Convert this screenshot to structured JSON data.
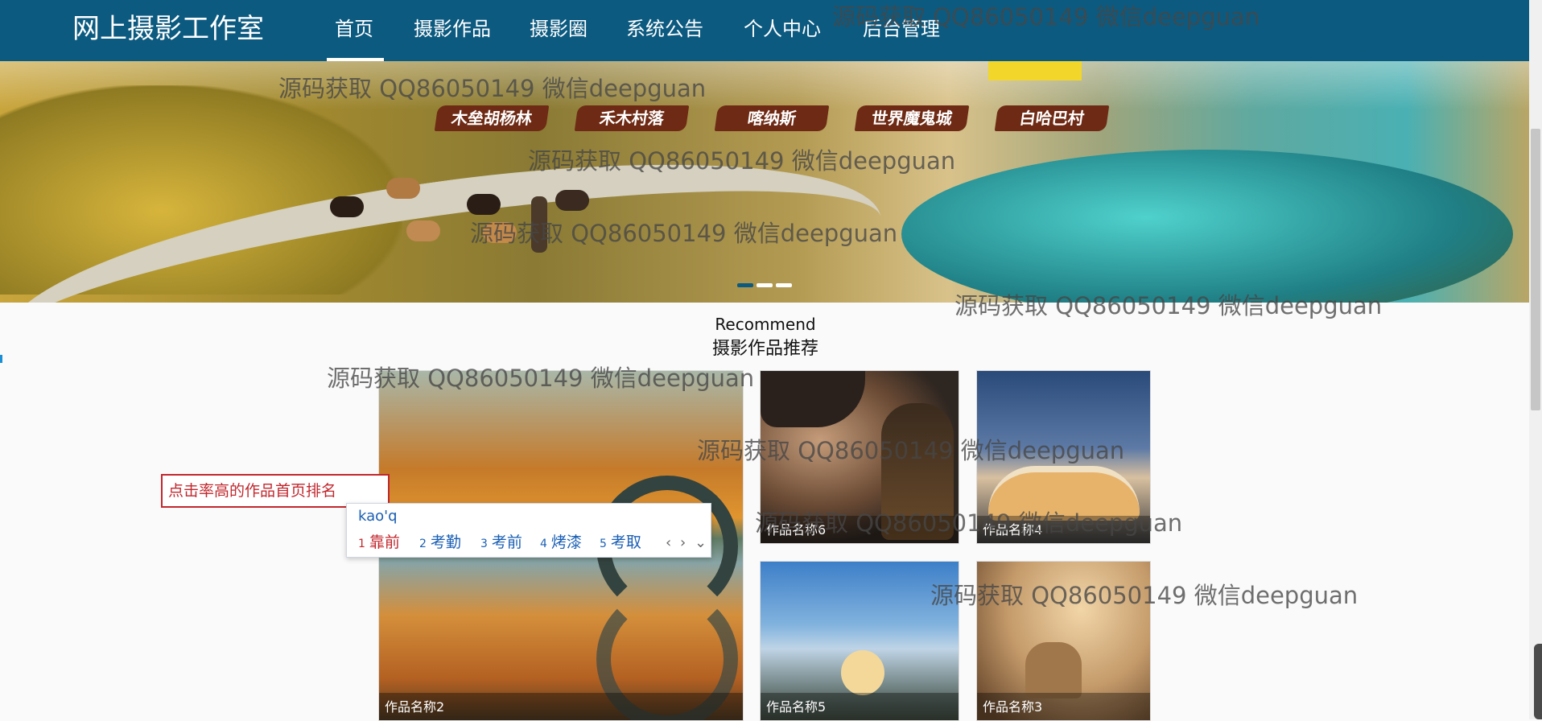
{
  "app": {
    "brand": "网上摄影工作室"
  },
  "nav": {
    "items": [
      "首页",
      "摄影作品",
      "摄影圈",
      "系统公告",
      "个人中心",
      "后台管理"
    ],
    "active_index": 0
  },
  "banner": {
    "tags": [
      "木垒胡杨林",
      "禾木村落",
      "喀纳斯",
      "世界魔鬼城",
      "白哈巴村"
    ],
    "carousel": {
      "count": 3,
      "active_index": 0
    }
  },
  "recommend": {
    "title_en": "Recommend",
    "title_zh": "摄影作品推荐",
    "items": [
      {
        "name": "作品名称2"
      },
      {
        "name": "作品名称6"
      },
      {
        "name": "作品名称4"
      },
      {
        "name": "作品名称5"
      },
      {
        "name": "作品名称3"
      }
    ]
  },
  "rank_input": {
    "value": "点击率高的作品首页排名"
  },
  "ime": {
    "composition": "kao'q",
    "candidates": [
      {
        "index": "1",
        "text": "靠前"
      },
      {
        "index": "2",
        "text": "考勤"
      },
      {
        "index": "3",
        "text": "考前"
      },
      {
        "index": "4",
        "text": "烤漆"
      },
      {
        "index": "5",
        "text": "考取"
      }
    ],
    "selected_index": 0,
    "controls": {
      "prev": "‹",
      "next": "›",
      "expand": "⌄"
    }
  },
  "watermark": "源码获取 QQ86050149 微信deepguan",
  "colors": {
    "nav_bg": "#0c5a80",
    "accent_red": "#c1272d",
    "ime_blue": "#1a5fb4"
  }
}
